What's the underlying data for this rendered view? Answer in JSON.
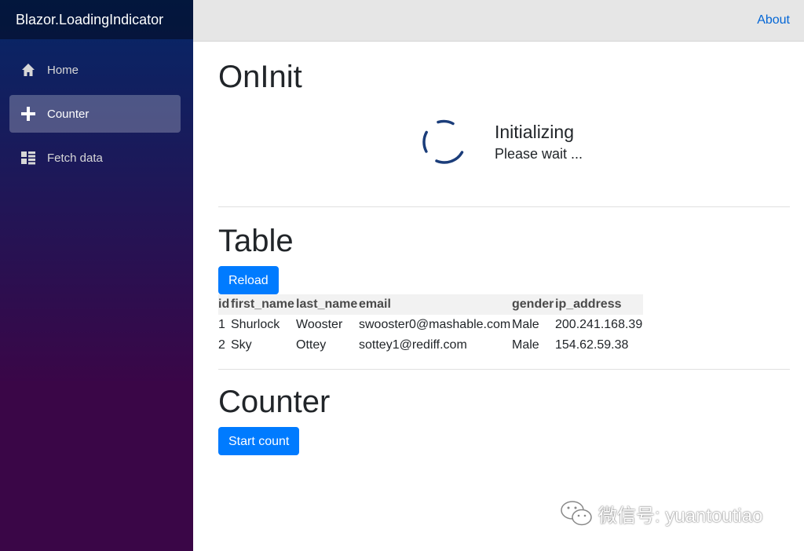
{
  "sidebar": {
    "brand": "Blazor.LoadingIndicator",
    "items": [
      {
        "label": "Home",
        "icon": "home-icon",
        "active": false
      },
      {
        "label": "Counter",
        "icon": "plus-icon",
        "active": true
      },
      {
        "label": "Fetch data",
        "icon": "list-icon",
        "active": false
      }
    ]
  },
  "topbar": {
    "about_label": "About"
  },
  "sections": {
    "oninit": {
      "heading": "OnInit",
      "loading_title": "Initializing",
      "loading_subtitle": "Please wait ..."
    },
    "table": {
      "heading": "Table",
      "reload_label": "Reload",
      "columns": [
        "id",
        "first_name",
        "last_name",
        "email",
        "gender",
        "ip_address"
      ],
      "rows": [
        [
          "1",
          "Shurlock",
          "Wooster",
          "swooster0@mashable.com",
          "Male",
          "200.241.168.39"
        ],
        [
          "2",
          "Sky",
          "Ottey",
          "sottey1@rediff.com",
          "Male",
          "154.62.59.38"
        ]
      ]
    },
    "counter": {
      "heading": "Counter",
      "start_label": "Start count"
    }
  },
  "watermark": {
    "text": "微信号: yuantoutiao"
  },
  "colors": {
    "primary": "#007bff",
    "link": "#0366d6",
    "spinner": "#1b3d7a",
    "sidebar_top": "#052767",
    "sidebar_bottom": "#3a0647"
  }
}
